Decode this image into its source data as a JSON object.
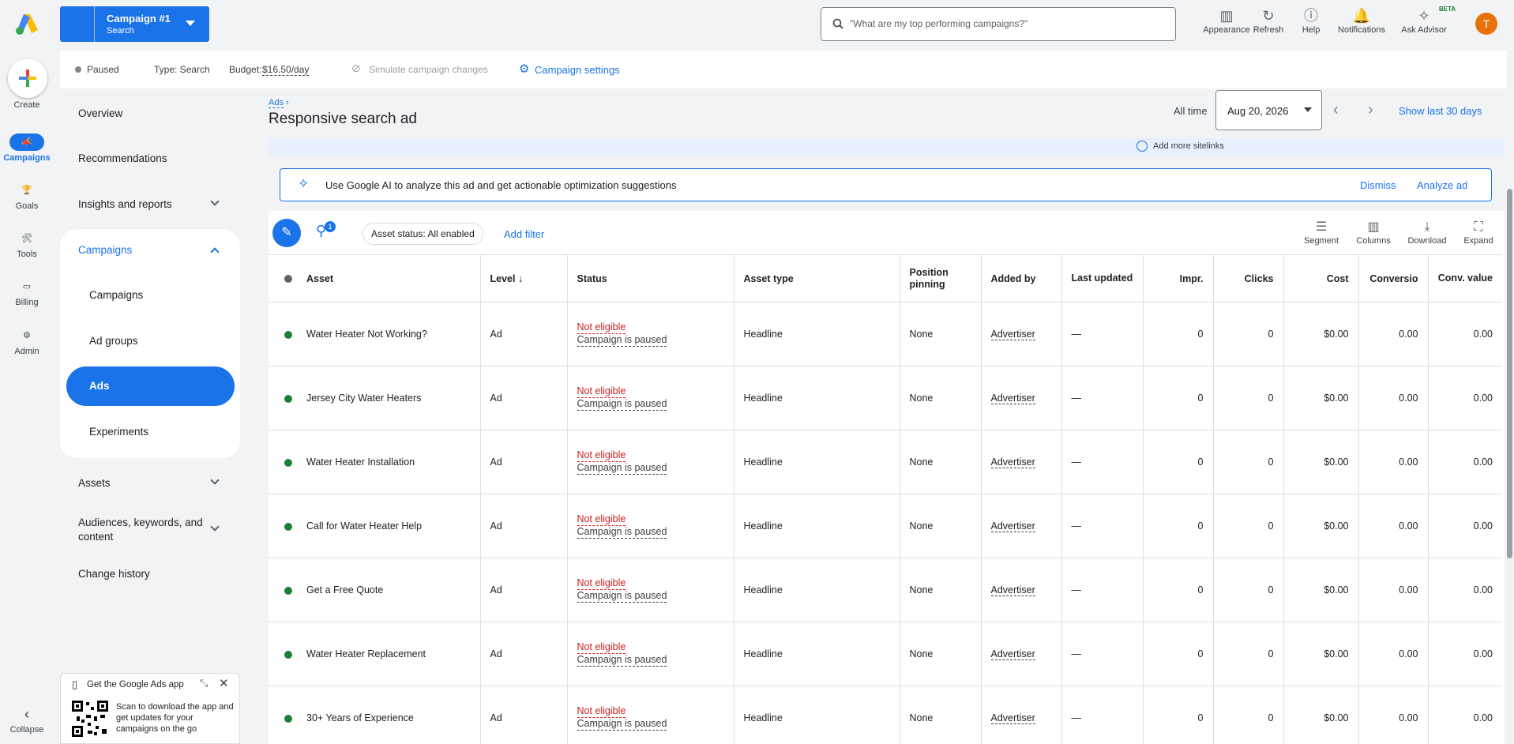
{
  "rail": {
    "create": "Create",
    "items": [
      {
        "label": "Campaigns"
      },
      {
        "label": "Goals"
      },
      {
        "label": "Tools"
      },
      {
        "label": "Billing"
      },
      {
        "label": "Admin"
      }
    ],
    "collapse": "Collapse"
  },
  "campaign_selector": {
    "name": "Campaign #1",
    "type": "Search"
  },
  "search": {
    "placeholder": "\"What are my top performing campaigns?\""
  },
  "top_actions": [
    {
      "label": "Appearance"
    },
    {
      "label": "Refresh"
    },
    {
      "label": "Help"
    },
    {
      "label": "Notifications"
    },
    {
      "label": "Ask Advisor",
      "badge": "BETA"
    }
  ],
  "avatar": "T",
  "status_strip": {
    "status": "Paused",
    "type": "Type: Search",
    "budget_label": "Budget:",
    "budget_value": "$16.50/day",
    "simulate": "Simulate campaign changes",
    "settings": "Campaign settings"
  },
  "nav": {
    "overview": "Overview",
    "recommendations": "Recommendations",
    "insights": "Insights and reports",
    "campaigns_group": "Campaigns",
    "sub": [
      "Campaigns",
      "Ad groups",
      "Ads",
      "Experiments"
    ],
    "assets": "Assets",
    "audiences": "Audiences, keywords, and content",
    "change_history": "Change history"
  },
  "promo": {
    "title": "Get the Google Ads app",
    "body": "Scan to download the app and get updates for your campaigns on the go"
  },
  "page": {
    "breadcrumb": "Ads",
    "title": "Responsive search ad",
    "date_range_label": "All time",
    "date_value": "Aug 20, 2026",
    "show_last": "Show last 30 days",
    "sitelinks": "Add more sitelinks"
  },
  "ai_banner": {
    "text": "Use Google AI to analyze this ad and get actionable optimization suggestions",
    "dismiss": "Dismiss",
    "analyze": "Analyze ad"
  },
  "filters": {
    "filter_count": "1",
    "chip": "Asset status: All enabled",
    "add_filter": "Add filter"
  },
  "table_tools": [
    "Segment",
    "Columns",
    "Download",
    "Expand"
  ],
  "table": {
    "headers": {
      "asset": "Asset",
      "level": "Level",
      "status": "Status",
      "asset_type": "Asset type",
      "position_pinning": "Position pinning",
      "added_by": "Added by",
      "last_updated": "Last updated",
      "impr": "Impr.",
      "clicks": "Clicks",
      "cost": "Cost",
      "conversions": "Conversio",
      "conv_value": "Conv. value"
    },
    "rows": [
      {
        "asset": "Water Heater Not Working?",
        "level": "Ad",
        "status1": "Not eligible",
        "status2": "Campaign is paused",
        "type": "Headline",
        "pinning": "None",
        "added_by": "Advertiser",
        "updated": "—",
        "impr": "0",
        "clicks": "0",
        "cost": "$0.00",
        "conv": "0.00",
        "value": "0.00"
      },
      {
        "asset": "Jersey City Water Heaters",
        "level": "Ad",
        "status1": "Not eligible",
        "status2": "Campaign is paused",
        "type": "Headline",
        "pinning": "None",
        "added_by": "Advertiser",
        "updated": "—",
        "impr": "0",
        "clicks": "0",
        "cost": "$0.00",
        "conv": "0.00",
        "value": "0.00"
      },
      {
        "asset": "Water Heater Installation",
        "level": "Ad",
        "status1": "Not eligible",
        "status2": "Campaign is paused",
        "type": "Headline",
        "pinning": "None",
        "added_by": "Advertiser",
        "updated": "—",
        "impr": "0",
        "clicks": "0",
        "cost": "$0.00",
        "conv": "0.00",
        "value": "0.00"
      },
      {
        "asset": "Call for Water Heater Help",
        "level": "Ad",
        "status1": "Not eligible",
        "status2": "Campaign is paused",
        "type": "Headline",
        "pinning": "None",
        "added_by": "Advertiser",
        "updated": "—",
        "impr": "0",
        "clicks": "0",
        "cost": "$0.00",
        "conv": "0.00",
        "value": "0.00"
      },
      {
        "asset": "Get a Free Quote",
        "level": "Ad",
        "status1": "Not eligible",
        "status2": "Campaign is paused",
        "type": "Headline",
        "pinning": "None",
        "added_by": "Advertiser",
        "updated": "—",
        "impr": "0",
        "clicks": "0",
        "cost": "$0.00",
        "conv": "0.00",
        "value": "0.00"
      },
      {
        "asset": "Water Heater Replacement",
        "level": "Ad",
        "status1": "Not eligible",
        "status2": "Campaign is paused",
        "type": "Headline",
        "pinning": "None",
        "added_by": "Advertiser",
        "updated": "—",
        "impr": "0",
        "clicks": "0",
        "cost": "$0.00",
        "conv": "0.00",
        "value": "0.00"
      },
      {
        "asset": "30+ Years of Experience",
        "level": "Ad",
        "status1": "Not eligible",
        "status2": "Campaign is paused",
        "type": "Headline",
        "pinning": "None",
        "added_by": "Advertiser",
        "updated": "—",
        "impr": "0",
        "clicks": "0",
        "cost": "$0.00",
        "conv": "0.00",
        "value": "0.00"
      }
    ]
  },
  "colors": {
    "accent": "#1a73e8",
    "status_enabled": "#188038",
    "error": "#c5221f",
    "avatar": "#e8710a"
  }
}
